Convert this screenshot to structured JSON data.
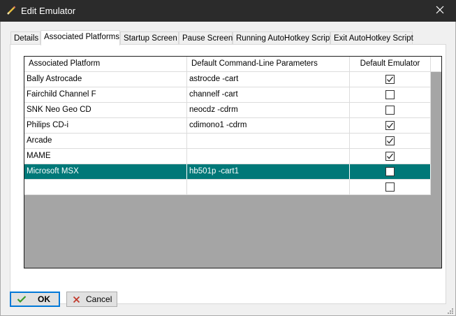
{
  "window": {
    "title": "Edit Emulator",
    "icon": "pencil-icon",
    "close_icon": "close-icon"
  },
  "tabs": [
    {
      "label": "Details"
    },
    {
      "label": "Associated Platforms",
      "active": true
    },
    {
      "label": "Startup Screen"
    },
    {
      "label": "Pause Screen"
    },
    {
      "label": "Running AutoHotkey Script"
    },
    {
      "label": "Exit AutoHotkey Script"
    }
  ],
  "grid": {
    "columns": [
      "Associated Platform",
      "Default Command-Line Parameters",
      "Default Emulator"
    ],
    "rows": [
      {
        "platform": "Bally Astrocade",
        "params": "astrocde -cart",
        "default": true
      },
      {
        "platform": "Fairchild Channel F",
        "params": "channelf -cart",
        "default": false
      },
      {
        "platform": "SNK Neo Geo CD",
        "params": "neocdz -cdrm",
        "default": false
      },
      {
        "platform": "Philips CD-i",
        "params": "cdimono1 -cdrm",
        "default": true
      },
      {
        "platform": "Arcade",
        "params": "",
        "default": true
      },
      {
        "platform": "MAME",
        "params": "",
        "default": true
      },
      {
        "platform": "Microsoft MSX",
        "params": "hb501p -cart1",
        "default": false,
        "selected": true
      },
      {
        "platform": "",
        "params": "",
        "default": false
      }
    ],
    "selected_color": "#007878"
  },
  "buttons": {
    "ok_label": "OK",
    "cancel_label": "Cancel"
  },
  "colors": {
    "titlebar": "#2b2b2b",
    "focus_border": "#0078d7",
    "ok_check": "#3a9a2a",
    "cancel_x": "#c0392b"
  }
}
